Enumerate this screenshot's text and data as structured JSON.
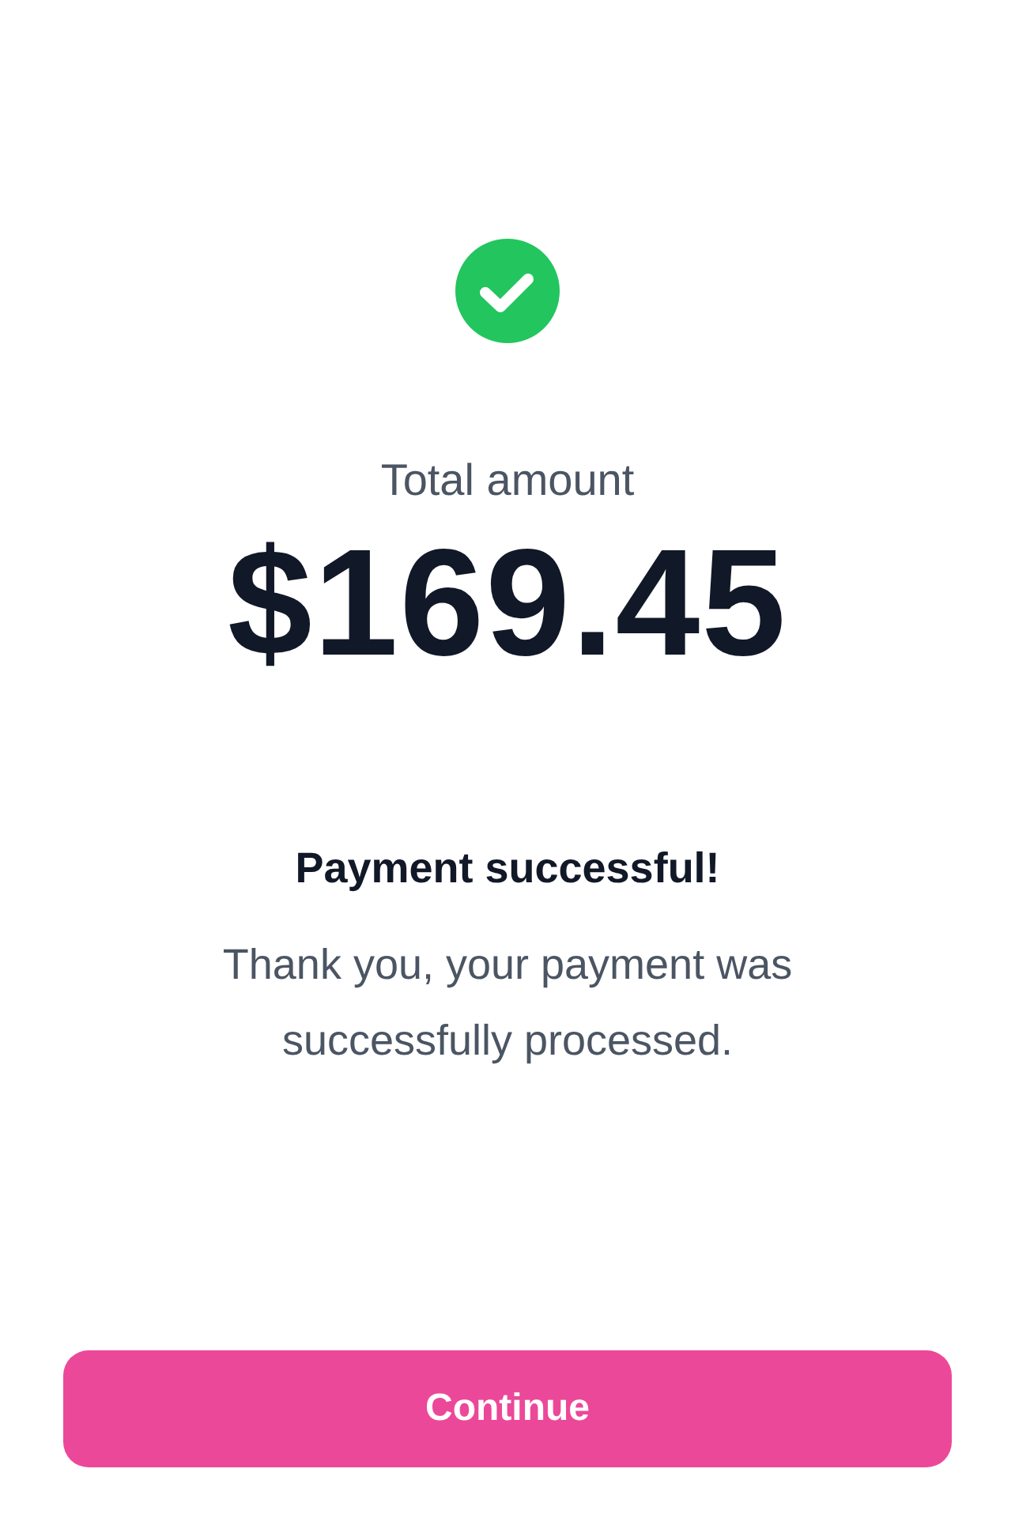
{
  "summary": {
    "label": "Total amount",
    "amount": "$169.45"
  },
  "message": {
    "title": "Payment successful!",
    "body": "Thank you, your payment was successfully processed."
  },
  "actions": [
    {
      "kind": "primary",
      "label": "Continue"
    }
  ]
}
